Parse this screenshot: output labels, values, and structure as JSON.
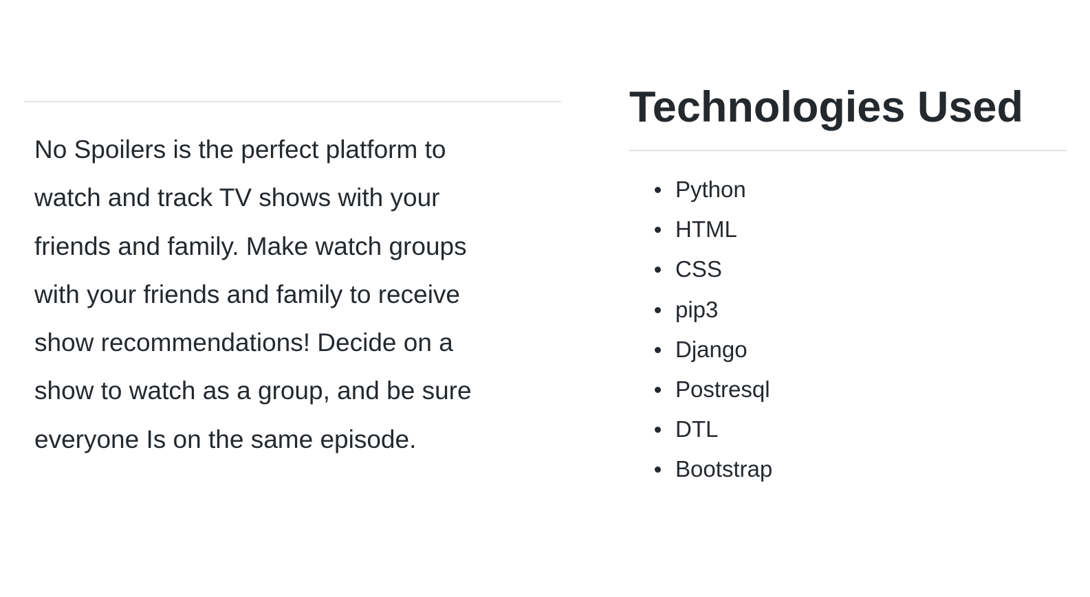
{
  "about": {
    "description": "No Spoilers is the perfect platform to watch and track TV shows with your friends and family. Make watch groups with your friends and family to receive show recommendations! Decide on a show to watch as a group, and be sure everyone Is on the same episode."
  },
  "technologies": {
    "heading": "Technologies Used",
    "items": [
      {
        "label": "Python"
      },
      {
        "label": "HTML"
      },
      {
        "label": "CSS"
      },
      {
        "label": "pip3"
      },
      {
        "label": "Django"
      },
      {
        "label": "Postresql"
      },
      {
        "label": "DTL"
      },
      {
        "label": "Bootstrap"
      }
    ]
  }
}
